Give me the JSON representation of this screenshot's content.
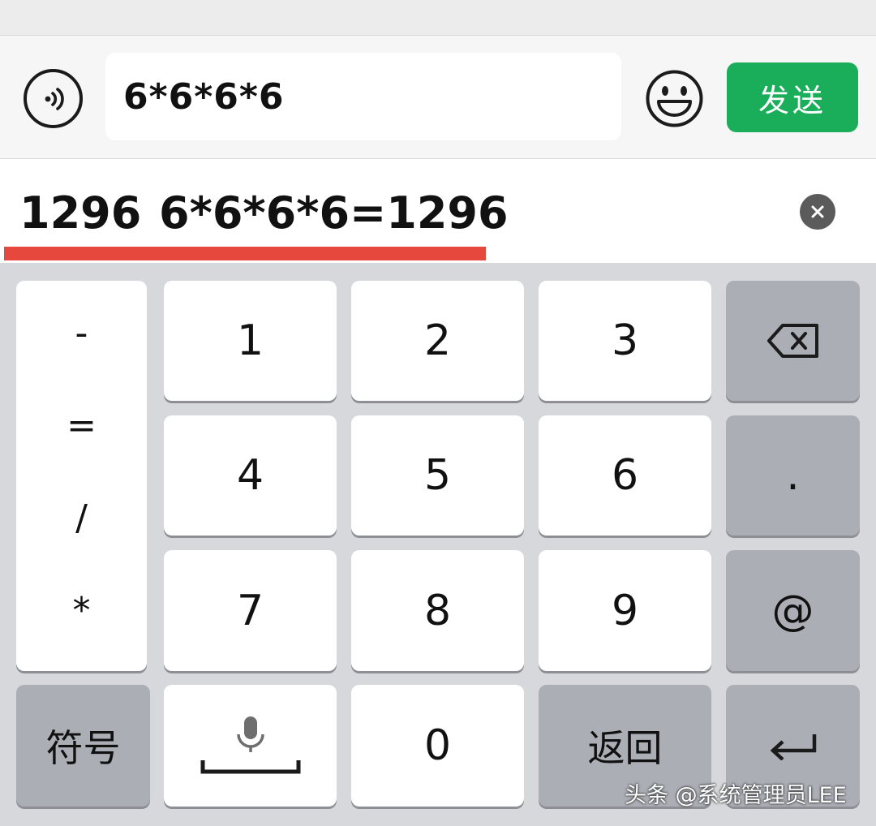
{
  "input_bar": {
    "text_value": "6*6*6*6",
    "send_label": "发送"
  },
  "candidates": [
    {
      "text": "1296"
    },
    {
      "text": "6*6*6*6=1296"
    }
  ],
  "keyboard": {
    "symbols": [
      "-",
      "=",
      "/",
      "*"
    ],
    "digits": [
      "1",
      "2",
      "3",
      "4",
      "5",
      "6",
      "7",
      "8",
      "9",
      "0"
    ],
    "dot": ".",
    "at": "@",
    "symbols_toggle": "符号",
    "return_label": "返回"
  },
  "watermark": "头条 @系统管理员LEE",
  "colors": {
    "send_green": "#1aad5a",
    "candidate_underline": "#e6483d",
    "keyboard_bg": "#d7d8dc",
    "function_key": "#abaeb5"
  },
  "icons": {
    "voice": "voice-input-icon",
    "emoji": "smiley-emoji-icon",
    "clear": "clear-x-icon",
    "backspace": "backspace-icon",
    "mic_space": "microphone-space-icon",
    "enter": "enter-return-icon"
  }
}
